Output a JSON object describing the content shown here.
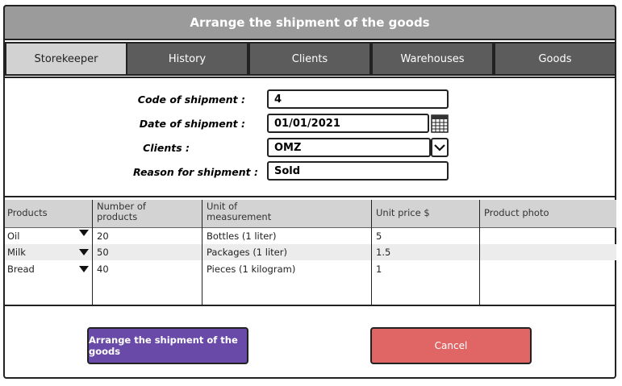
{
  "window": {
    "title": "Arrange the shipment of the goods"
  },
  "tabs": [
    {
      "label": "Storekeeper",
      "active": true
    },
    {
      "label": "History"
    },
    {
      "label": "Clients"
    },
    {
      "label": "Warehouses"
    },
    {
      "label": "Goods"
    }
  ],
  "form": {
    "code_label": "Code of shipment :",
    "code_value": "4",
    "date_label": "Date of shipment :",
    "date_value": "01/01/2021",
    "clients_label": "Clients :",
    "clients_value": "OMZ",
    "reason_label": "Reason for shipment :",
    "reason_value": "Sold"
  },
  "table": {
    "columns": [
      "Products",
      "Number of products",
      "Unit of measurement",
      "Unit price $",
      "Product photo"
    ],
    "rows": [
      {
        "product": "Oil",
        "count": "20",
        "unit": "Bottles (1 liter)",
        "price": "5"
      },
      {
        "product": "Milk",
        "count": "50",
        "unit": "Packages (1 liter)",
        "price": "1.5"
      },
      {
        "product": "Bread",
        "count": "40",
        "unit": "Pieces (1 kilogram)",
        "price": "1"
      }
    ]
  },
  "actions": {
    "primary_label": "Arrange the shipment of the goods",
    "cancel_label": "Cancel"
  },
  "colors": {
    "primary": "#6a4aa8",
    "cancel": "#e06666",
    "title_bar": "#9b9b9b",
    "tab_inactive": "#5c5c5c",
    "tab_active": "#d2d2d2"
  },
  "icons": {
    "date_picker": "calendar-icon",
    "clients_dropdown": "chevron-down-icon",
    "product_dropdown": "triangle-down-icon"
  }
}
